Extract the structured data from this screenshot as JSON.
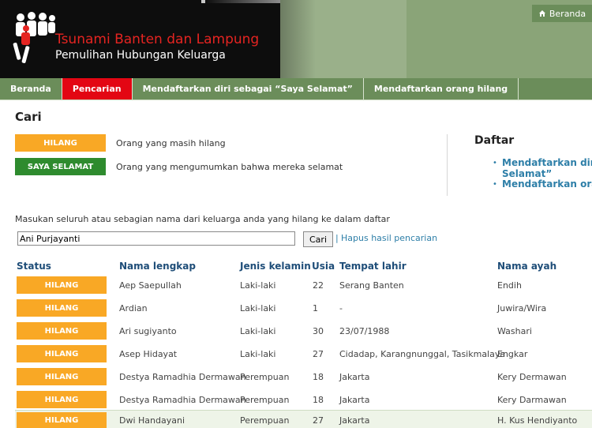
{
  "header": {
    "title": "Tsunami Banten dan Lampung",
    "subtitle": "Pemulihan Hubungan Keluarga",
    "home_link": "Beranda"
  },
  "nav": {
    "items": [
      {
        "label": "Beranda"
      },
      {
        "label": "Pencarian"
      },
      {
        "label": "Mendaftarkan diri sebagai “Saya Selamat”"
      },
      {
        "label": "Mendaftarkan orang hilang"
      }
    ]
  },
  "main": {
    "title": "Cari",
    "legend": [
      {
        "badge": "HILANG",
        "description": "Orang yang masih hilang"
      },
      {
        "badge": "SAYA SELAMAT",
        "description": "Orang yang mengumumkan bahwa mereka selamat"
      }
    ]
  },
  "daftar": {
    "title": "Daftar",
    "link1_line1": "Mendaftarkan diri",
    "link1_line2": "Selamat”",
    "link2": "Mendaftarkan oran"
  },
  "search": {
    "label": "Masukan seluruh atau sebagian nama dari keluarga anda yang hilang ke dalam daftar",
    "value": "Ani Purjayanti",
    "button": "Cari",
    "separator": "|",
    "clear": "Hapus hasil pencarian"
  },
  "table": {
    "columns": [
      "Status",
      "Nama lengkap",
      "Jenis kelamin",
      "Usia",
      "Tempat lahir",
      "Nama ayah"
    ],
    "rows": [
      {
        "status": "HILANG",
        "name": "Aep Saepullah",
        "gender": "Laki-laki",
        "age": "22",
        "birthplace": "Serang Banten",
        "father": "Endih"
      },
      {
        "status": "HILANG",
        "name": "Ardian",
        "gender": "Laki-laki",
        "age": "1",
        "birthplace": "-",
        "father": "Juwira/Wira"
      },
      {
        "status": "HILANG",
        "name": "Ari sugiyanto",
        "gender": "Laki-laki",
        "age": "30",
        "birthplace": "23/07/1988",
        "father": "Washari"
      },
      {
        "status": "HILANG",
        "name": "Asep Hidayat",
        "gender": "Laki-laki",
        "age": "27",
        "birthplace": "Cidadap, Karangnunggal, Tasikmalaya",
        "father": "Engkar"
      },
      {
        "status": "HILANG",
        "name": "Destya Ramadhia Dermawan",
        "gender": "Perempuan",
        "age": "18",
        "birthplace": "Jakarta",
        "father": "Kery Dermawan"
      },
      {
        "status": "HILANG",
        "name": "Destya Ramadhia Dermawan",
        "gender": "Perempuan",
        "age": "18",
        "birthplace": "Jakarta",
        "father": "Kery Darmawan"
      },
      {
        "status": "HILANG",
        "name": "Dwi Handayani",
        "gender": "Perempuan",
        "age": "27",
        "birthplace": "Jakarta",
        "father": "H. Kus Hendiyanto"
      }
    ]
  },
  "colors": {
    "nav_green": "#6b8d5a",
    "active_red": "#e30613",
    "hilang_orange": "#f9a825",
    "selamat_green": "#2e8b2e",
    "link_blue": "#2e7fa8",
    "header_blue": "#1e4d78"
  }
}
